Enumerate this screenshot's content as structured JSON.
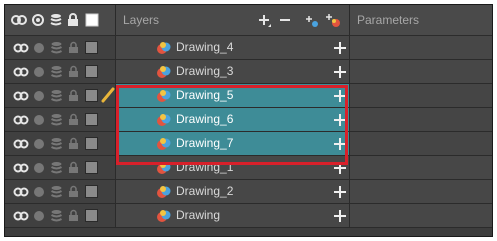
{
  "header": {
    "layers_label": "Layers",
    "parameters_label": "Parameters"
  },
  "layers": [
    {
      "name": "Drawing_4",
      "selected": false
    },
    {
      "name": "Drawing_3",
      "selected": false
    },
    {
      "name": "Drawing_5",
      "selected": true
    },
    {
      "name": "Drawing_6",
      "selected": true
    },
    {
      "name": "Drawing_7",
      "selected": true
    },
    {
      "name": "Drawing_1",
      "selected": false
    },
    {
      "name": "Drawing_2",
      "selected": false
    },
    {
      "name": "Drawing",
      "selected": false
    }
  ],
  "colors": {
    "selection_fill": "#3e8c97",
    "selection_outline": "#d8202a",
    "pencil": "#e8b53a"
  },
  "icons": {
    "header": [
      "animate-onion-icon",
      "visibility-dot-icon",
      "stack-icon",
      "lock-icon",
      "color-swatch-icon"
    ],
    "row": [
      "animate-onion-icon",
      "visibility-dot-icon",
      "stack-icon",
      "lock-icon",
      "color-swatch-icon",
      "drawing-layer-icon",
      "add-icon"
    ],
    "current_layer_marker": "pencil-icon"
  }
}
